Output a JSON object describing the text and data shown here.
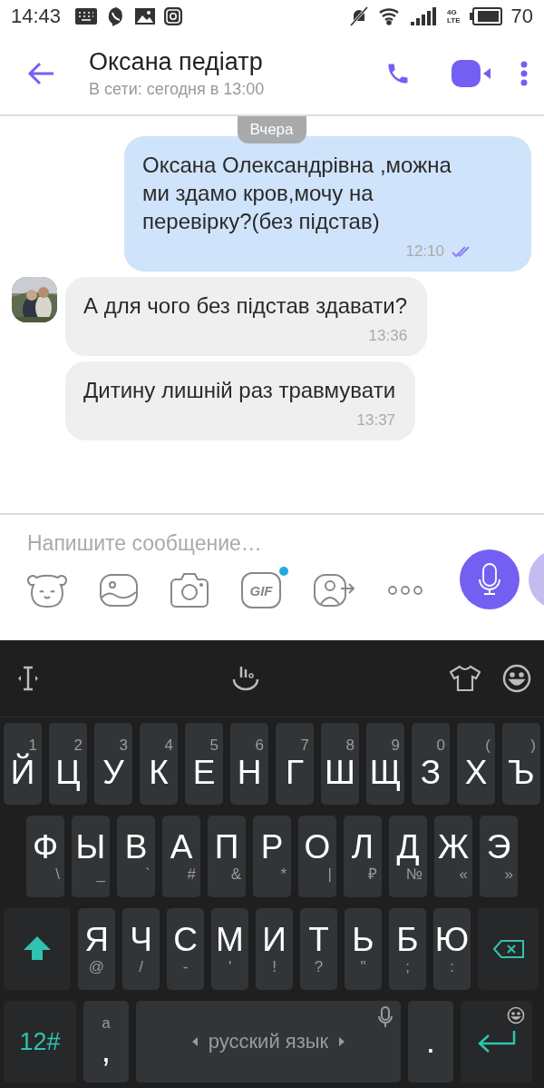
{
  "status_bar": {
    "time": "14:43",
    "network": "4G",
    "network_sub": "LTE",
    "battery": "70"
  },
  "header": {
    "title": "Оксана педіатр",
    "subtitle": "В сети: сегодня в 13:00"
  },
  "chat": {
    "date": "Вчера",
    "messages": [
      {
        "kind": "outgoing",
        "text": "Оксана Олександрівна ,можна ми здамо кров,мочу на перевірку?(без підстав)",
        "time": "12:10",
        "read": true
      },
      {
        "kind": "incoming",
        "text": "А для чого без підстав здавати?",
        "time": "13:36",
        "show_avatar": true
      },
      {
        "kind": "incoming",
        "text": "Дитину лишній раз травмувати",
        "time": "13:37",
        "show_avatar": false
      }
    ]
  },
  "composer": {
    "placeholder": "Напишите сообщение…",
    "gif_label": "GIF",
    "gif_new": true
  },
  "keyboard": {
    "rows": [
      {
        "keys": [
          {
            "kind": "letter",
            "label": "Й",
            "hint": "1"
          },
          {
            "kind": "letter",
            "label": "Ц",
            "hint": "2"
          },
          {
            "kind": "letter",
            "label": "У",
            "hint": "3"
          },
          {
            "kind": "letter",
            "label": "К",
            "hint": "4"
          },
          {
            "kind": "letter",
            "label": "Е",
            "hint": "5"
          },
          {
            "kind": "letter",
            "label": "Н",
            "hint": "6"
          },
          {
            "kind": "letter",
            "label": "Г",
            "hint": "7"
          },
          {
            "kind": "letter",
            "label": "Ш",
            "hint": "8"
          },
          {
            "kind": "letter",
            "label": "Щ",
            "hint": "9"
          },
          {
            "kind": "letter",
            "label": "З",
            "hint": "0"
          },
          {
            "kind": "letter",
            "label": "Х",
            "hint": "("
          },
          {
            "kind": "letter",
            "label": "Ъ",
            "hint": ")"
          }
        ]
      },
      {
        "keys": [
          {
            "kind": "letter",
            "label": "Ф",
            "hint": "\\"
          },
          {
            "kind": "letter",
            "label": "Ы",
            "hint": "_"
          },
          {
            "kind": "letter",
            "label": "В",
            "hint": "`"
          },
          {
            "kind": "letter",
            "label": "А",
            "hint": "#"
          },
          {
            "kind": "letter",
            "label": "П",
            "hint": "&"
          },
          {
            "kind": "letter",
            "label": "Р",
            "hint": "*"
          },
          {
            "kind": "letter",
            "label": "О",
            "hint": "|"
          },
          {
            "kind": "letter",
            "label": "Л",
            "hint": "₽"
          },
          {
            "kind": "letter",
            "label": "Д",
            "hint": "№"
          },
          {
            "kind": "letter",
            "label": "Ж",
            "hint": "«"
          },
          {
            "kind": "letter",
            "label": "Э",
            "hint": "»"
          }
        ]
      },
      {
        "keys": [
          {
            "kind": "shift"
          },
          {
            "kind": "letter",
            "label": "Я",
            "hint": "@"
          },
          {
            "kind": "letter",
            "label": "Ч",
            "hint": "/"
          },
          {
            "kind": "letter",
            "label": "С",
            "hint": "-"
          },
          {
            "kind": "letter",
            "label": "М",
            "hint": "'"
          },
          {
            "kind": "letter",
            "label": "И",
            "hint": "!"
          },
          {
            "kind": "letter",
            "label": "Т",
            "hint": "?"
          },
          {
            "kind": "letter",
            "label": "Ь",
            "hint": "\""
          },
          {
            "kind": "letter",
            "label": "Б",
            "hint": ";"
          },
          {
            "kind": "letter",
            "label": "Ю",
            "hint": ":"
          },
          {
            "kind": "backspace"
          }
        ]
      },
      {
        "keys": [
          {
            "kind": "symbols",
            "label": "12#"
          },
          {
            "kind": "letter",
            "label": ",",
            "hint": "a"
          },
          {
            "kind": "space",
            "label": "русский язык"
          },
          {
            "kind": "letter",
            "label": "."
          },
          {
            "kind": "enter"
          }
        ]
      }
    ]
  }
}
